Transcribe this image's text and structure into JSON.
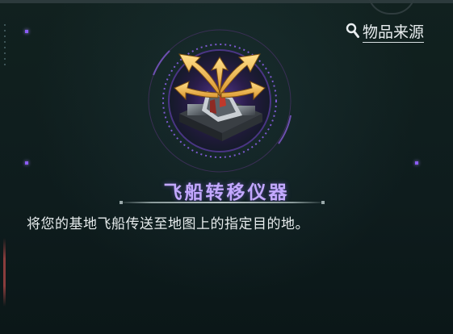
{
  "header": {
    "source_label": "物品来源"
  },
  "item": {
    "name": "飞船转移仪器",
    "description": "将您的基地飞船传送至地图上的指定目的地。"
  },
  "colors": {
    "background": "#0d1a1c",
    "title": "#c3a8ff",
    "accent_purple": "#8b5cf6",
    "arrow_gold": "#f0b84a",
    "text": "#e6ebec"
  },
  "icons": [
    "search-icon",
    "ship-transfer-item-icon"
  ]
}
